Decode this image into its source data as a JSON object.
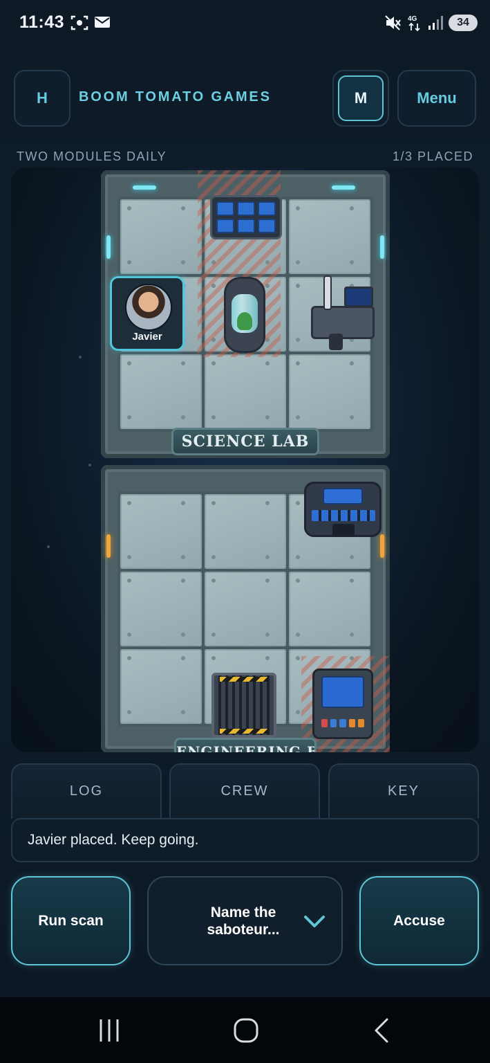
{
  "status_bar": {
    "time": "11:43",
    "network": "4G",
    "battery": "34",
    "icons_left": [
      "screen-record-icon",
      "mail-icon"
    ],
    "icons_right": [
      "mute-icon",
      "network-4g-icon",
      "signal-icon",
      "battery-icon"
    ]
  },
  "header": {
    "home_button": "H",
    "brand": "BOOM TOMATO GAMES",
    "m_button": "M",
    "menu_button": "Menu"
  },
  "subheader": {
    "mode": "TWO MODULES DAILY",
    "progress": "1/3 PLACED"
  },
  "board": {
    "modules": [
      {
        "label": "SCIENCE LAB",
        "accent_light": "#7fe6f4"
      },
      {
        "label": "ENGINEERING BAY",
        "accent_light": "#f0a43c"
      }
    ],
    "crew_token": {
      "name": "Javier"
    }
  },
  "tabs": [
    "LOG",
    "CREW",
    "KEY"
  ],
  "log_message": "Javier placed. Keep going.",
  "actions": {
    "scan": "Run scan",
    "select_placeholder": "Name the saboteur...",
    "accuse": "Accuse"
  },
  "colors": {
    "accent": "#5fc6d7",
    "background": "#0d1a26",
    "brand_text": "#6ccfe2"
  }
}
